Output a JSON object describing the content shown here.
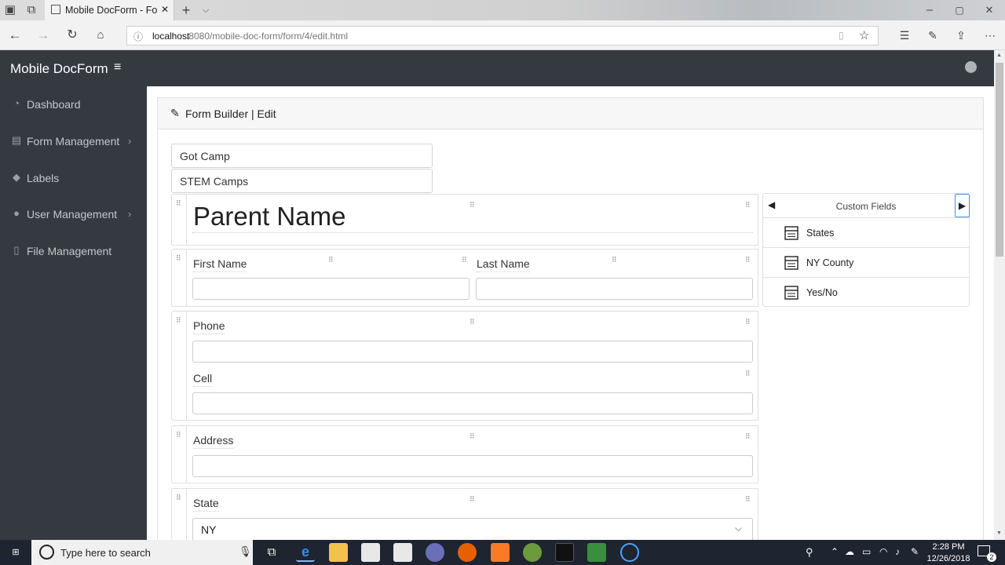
{
  "browser": {
    "tab_title": "Mobile DocForm - Form",
    "url_host": "localhost",
    "url_rest": ":8080/mobile-doc-form/form/4/edit.html"
  },
  "app": {
    "brand": "Mobile DocForm"
  },
  "sidebar": {
    "items": [
      {
        "label": "Dashboard",
        "icon": "dashboard-icon",
        "has_submenu": false
      },
      {
        "label": "Form Management",
        "icon": "form-icon",
        "has_submenu": true
      },
      {
        "label": "Labels",
        "icon": "tag-icon",
        "has_submenu": false
      },
      {
        "label": "User Management",
        "icon": "users-icon",
        "has_submenu": true
      },
      {
        "label": "File Management",
        "icon": "file-icon",
        "has_submenu": false
      }
    ]
  },
  "card": {
    "title": "Form Builder | Edit"
  },
  "form": {
    "name_value": "Got Camp",
    "category_value": "STEM Camps",
    "heading": "Parent Name",
    "fields": {
      "first_name": "First Name",
      "last_name": "Last Name",
      "phone": "Phone",
      "cell": "Cell",
      "address": "Address",
      "state": "State",
      "state_value": "NY"
    }
  },
  "custom_fields": {
    "title": "Custom Fields",
    "items": [
      "States",
      "NY County",
      "Yes/No"
    ]
  },
  "taskbar": {
    "search_placeholder": "Type here to search",
    "time": "2:28 PM",
    "date": "12/26/2018",
    "notification_count": "2"
  },
  "colors": {
    "sidebar_bg": "#343a40",
    "sidebar_text": "#c5c8cc",
    "taskbar_bg": "#1e2430"
  }
}
